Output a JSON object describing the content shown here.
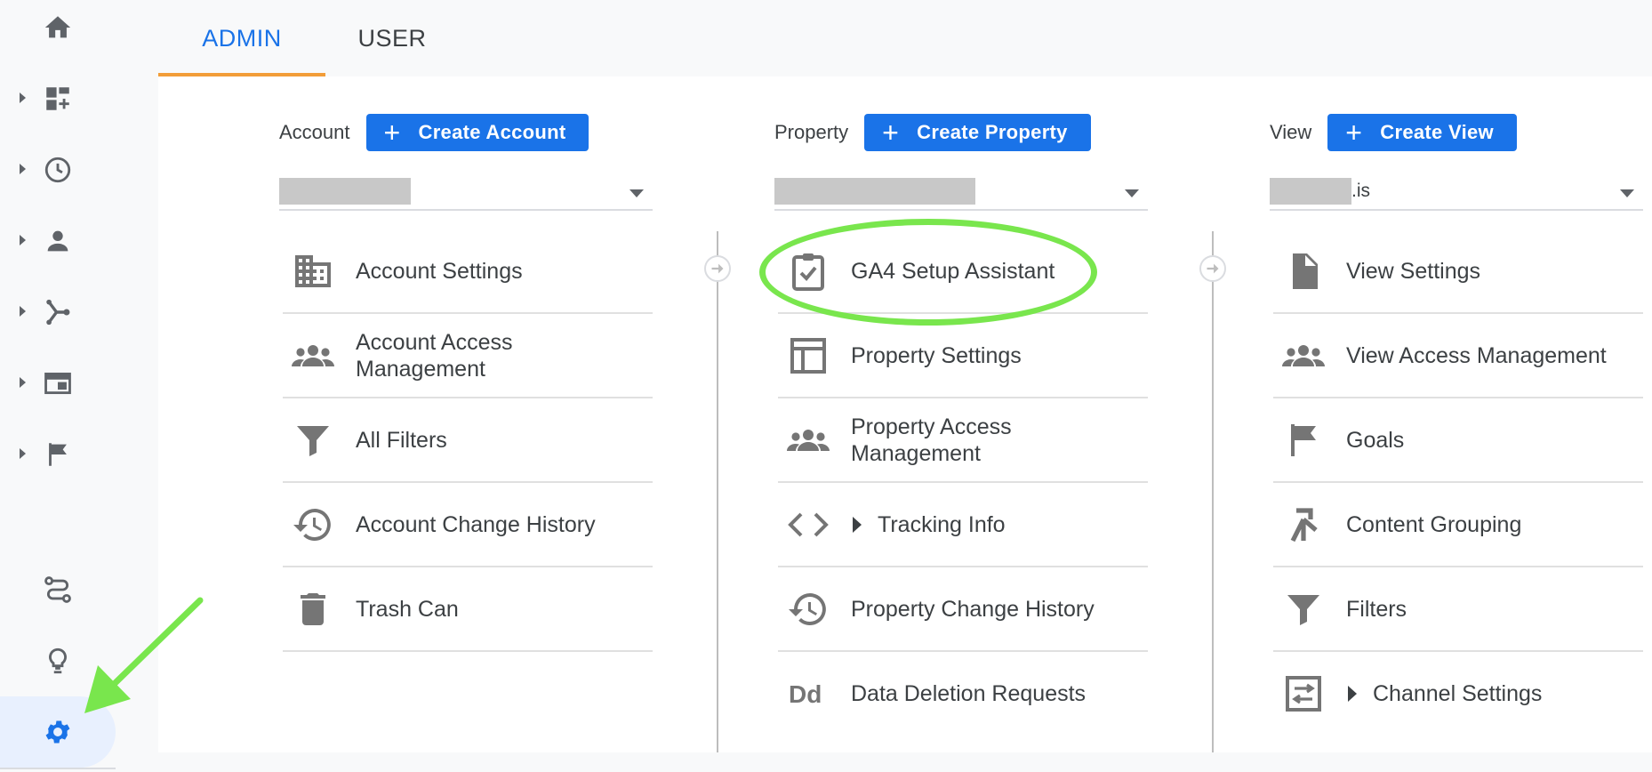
{
  "tabs": [
    {
      "label": "ADMIN",
      "active": true
    },
    {
      "label": "USER",
      "active": false
    }
  ],
  "left_nav": {
    "items": [
      {
        "icon": "home-icon"
      },
      {
        "icon": "customization-icon"
      },
      {
        "icon": "realtime-icon"
      },
      {
        "icon": "audience-icon"
      },
      {
        "icon": "acquisition-icon"
      },
      {
        "icon": "behavior-icon"
      },
      {
        "icon": "conversions-icon"
      },
      {
        "icon": "attribution-icon"
      },
      {
        "icon": "discover-icon"
      },
      {
        "icon": "admin-gear-icon"
      }
    ]
  },
  "account": {
    "title": "Account",
    "create_label": "Create Account",
    "selector_value": "",
    "menu": [
      {
        "label": "Account Settings",
        "icon": "building-icon"
      },
      {
        "label": "Account Access Management",
        "icon": "people-icon"
      },
      {
        "label": "All Filters",
        "icon": "filter-icon"
      },
      {
        "label": "Account Change History",
        "icon": "history-icon"
      },
      {
        "label": "Trash Can",
        "icon": "trash-icon"
      }
    ]
  },
  "property": {
    "title": "Property",
    "create_label": "Create Property",
    "selector_value": "",
    "menu": [
      {
        "label": "GA4 Setup Assistant",
        "icon": "clipboard-check-icon"
      },
      {
        "label": "Property Settings",
        "icon": "layout-icon"
      },
      {
        "label": "Property Access Management",
        "icon": "people-icon"
      },
      {
        "label": "Tracking Info",
        "icon": "code-icon",
        "expandable": true
      },
      {
        "label": "Property Change History",
        "icon": "history-icon"
      },
      {
        "label": "Data Deletion Requests",
        "icon": "dd-icon"
      }
    ]
  },
  "view": {
    "title": "View",
    "create_label": "Create View",
    "selector_value": ".is",
    "menu": [
      {
        "label": "View Settings",
        "icon": "document-icon"
      },
      {
        "label": "View Access Management",
        "icon": "people-icon"
      },
      {
        "label": "Goals",
        "icon": "flag-icon"
      },
      {
        "label": "Content Grouping",
        "icon": "grouping-icon"
      },
      {
        "label": "Filters",
        "icon": "filter-icon"
      },
      {
        "label": "Channel Settings",
        "icon": "channel-icon",
        "expandable": true
      }
    ]
  },
  "colors": {
    "primary": "#1a73e8",
    "tab_underline": "#f29d38",
    "annotation": "#79e64d",
    "icon_gray": "#757575"
  }
}
